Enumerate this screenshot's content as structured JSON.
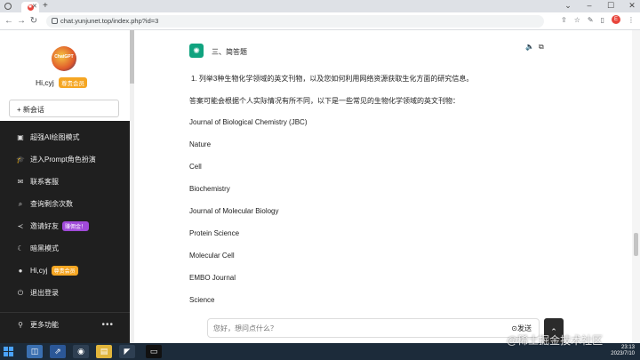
{
  "browser": {
    "url": "chat.yunjunet.top/index.php?id=3",
    "tab_icon": "chat-favicon",
    "avatar_letter": "E"
  },
  "sidebar": {
    "logo_text": "ChatGPT",
    "user_name": "Hi,cyj",
    "vip_label": "尊贵会员",
    "new_chat_label": "+ 新会话",
    "items": [
      {
        "icon": "image-icon",
        "glyph": "▣",
        "label": "超强AI绘图模式"
      },
      {
        "icon": "graduation-icon",
        "glyph": "🎓",
        "label": "进入Prompt角色扮演"
      },
      {
        "icon": "chat-icon",
        "glyph": "✉",
        "label": "联系客服"
      },
      {
        "icon": "search-icon",
        "glyph": "⌕",
        "label": "查询剩余次数"
      },
      {
        "icon": "share-icon",
        "glyph": "≺",
        "label": "邀请好友",
        "pill": "赚佣金！"
      },
      {
        "icon": "moon-icon",
        "glyph": "☾",
        "label": "暗黑模式"
      },
      {
        "icon": "user-icon",
        "glyph": "●",
        "label": "Hi,cyj",
        "pill": "尊贵会员"
      },
      {
        "icon": "power-icon",
        "glyph": "⏻",
        "label": "退出登录"
      }
    ],
    "more_label": "更多功能",
    "more_dots": "•••"
  },
  "main": {
    "section_title": "三、简答题",
    "question": "1. 列举3种生物化学领域的英文刊物，以及您如何利用网络资源获取生化方面的研究信息。",
    "answer_intro": "答案可能会根据个人实际情况有所不同，以下是一些常见的生物化学领域的英文刊物：",
    "journals": [
      "Journal of Biological Chemistry (JBC)",
      "Nature",
      "Cell",
      "Biochemistry",
      "Journal of Molecular Biology",
      "Protein Science",
      "Molecular Cell",
      "EMBO Journal",
      "Science"
    ],
    "input_placeholder": "您好，想问点什么？",
    "send_label": "⊙发送",
    "up_glyph": "⌃"
  },
  "taskbar": {
    "time": "23:13",
    "date": "2023/7/10"
  },
  "watermark": "@稀土掘金技术社区",
  "colors": {
    "sidebar_bg": "#1f1f1f",
    "gpt_green": "#10a37f",
    "vip_orange": "#f5a623",
    "invite_purple": "#a04ad9"
  }
}
